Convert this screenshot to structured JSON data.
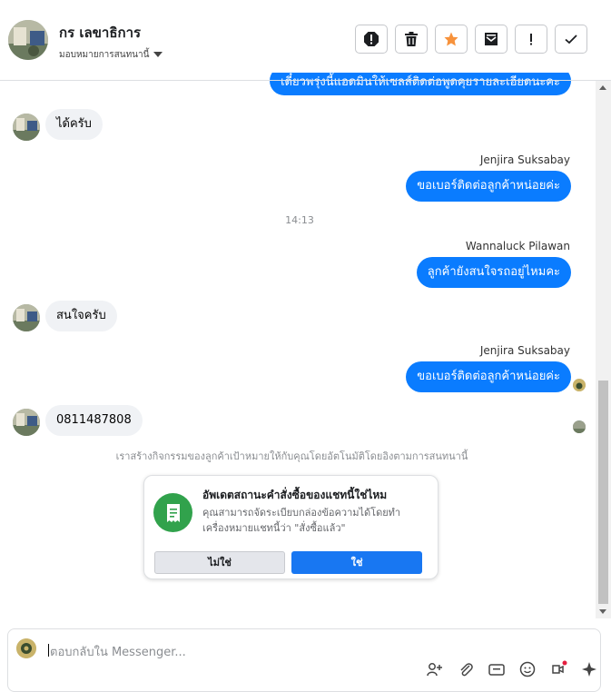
{
  "header": {
    "contact_name": "กร เลขาธิการ",
    "assign_label": "มอบหมายการสนทนานี้",
    "tools": [
      {
        "name": "report-icon",
        "label": "!"
      },
      {
        "name": "trash-icon",
        "label": ""
      },
      {
        "name": "star-icon",
        "label": ""
      },
      {
        "name": "mark-unread-icon",
        "label": ""
      },
      {
        "name": "important-icon",
        "label": "!"
      },
      {
        "name": "checkmark-icon",
        "label": ""
      }
    ]
  },
  "conversation": {
    "partial_top": "เดี๋ยวพรุ่งนี้แอดมินให้เซลส์ติดต่อพูดคุยรายละเอียดนะคะ",
    "msg1": "ได้ครับ",
    "sender1": "Jenjira Suksabay",
    "msg2": "ขอเบอร์ติดต่อลูกค้าหน่อยค่ะ",
    "time": "14:13",
    "sender2": "Wannaluck Pilawan",
    "msg3": "ลูกค้ายังสนใจรถอยู่ไหมคะ",
    "msg4": "สนใจครับ",
    "sender3": "Jenjira Suksabay",
    "msg5": "ขอเบอร์ติดต่อลูกค้าหน่อยค่ะ",
    "msg6": "0811487808",
    "system_note": "เราสร้างกิจกรรมของลูกค้าเป้าหมายให้กับคุณโดยอัตโนมัติโดยอิงตามการสนทนานี้"
  },
  "card": {
    "icon": "receipt-icon",
    "title": "อัพเดตสถานะคำสั่งซื้อของแชทนี้ใช่ไหม",
    "body": "คุณสามารถจัดระเบียบกล่องข้อความได้โดยทำเครื่องหมายแชทนี้ว่า \"สั่งซื้อแล้ว\"",
    "no_label": "ไม่ใช่",
    "yes_label": "ใช่"
  },
  "composer": {
    "placeholder": "ตอบกลับใน Messenger...",
    "tools": [
      "add-person-icon",
      "attach-icon",
      "gif-icon",
      "emoji-icon",
      "saved-reply-icon",
      "sparkle-icon"
    ]
  },
  "colors": {
    "accent": "#0a7cff",
    "button": "#1877f2",
    "star": "#f7923b",
    "success": "#31a24c",
    "unread_dot": "#e41e3f"
  }
}
